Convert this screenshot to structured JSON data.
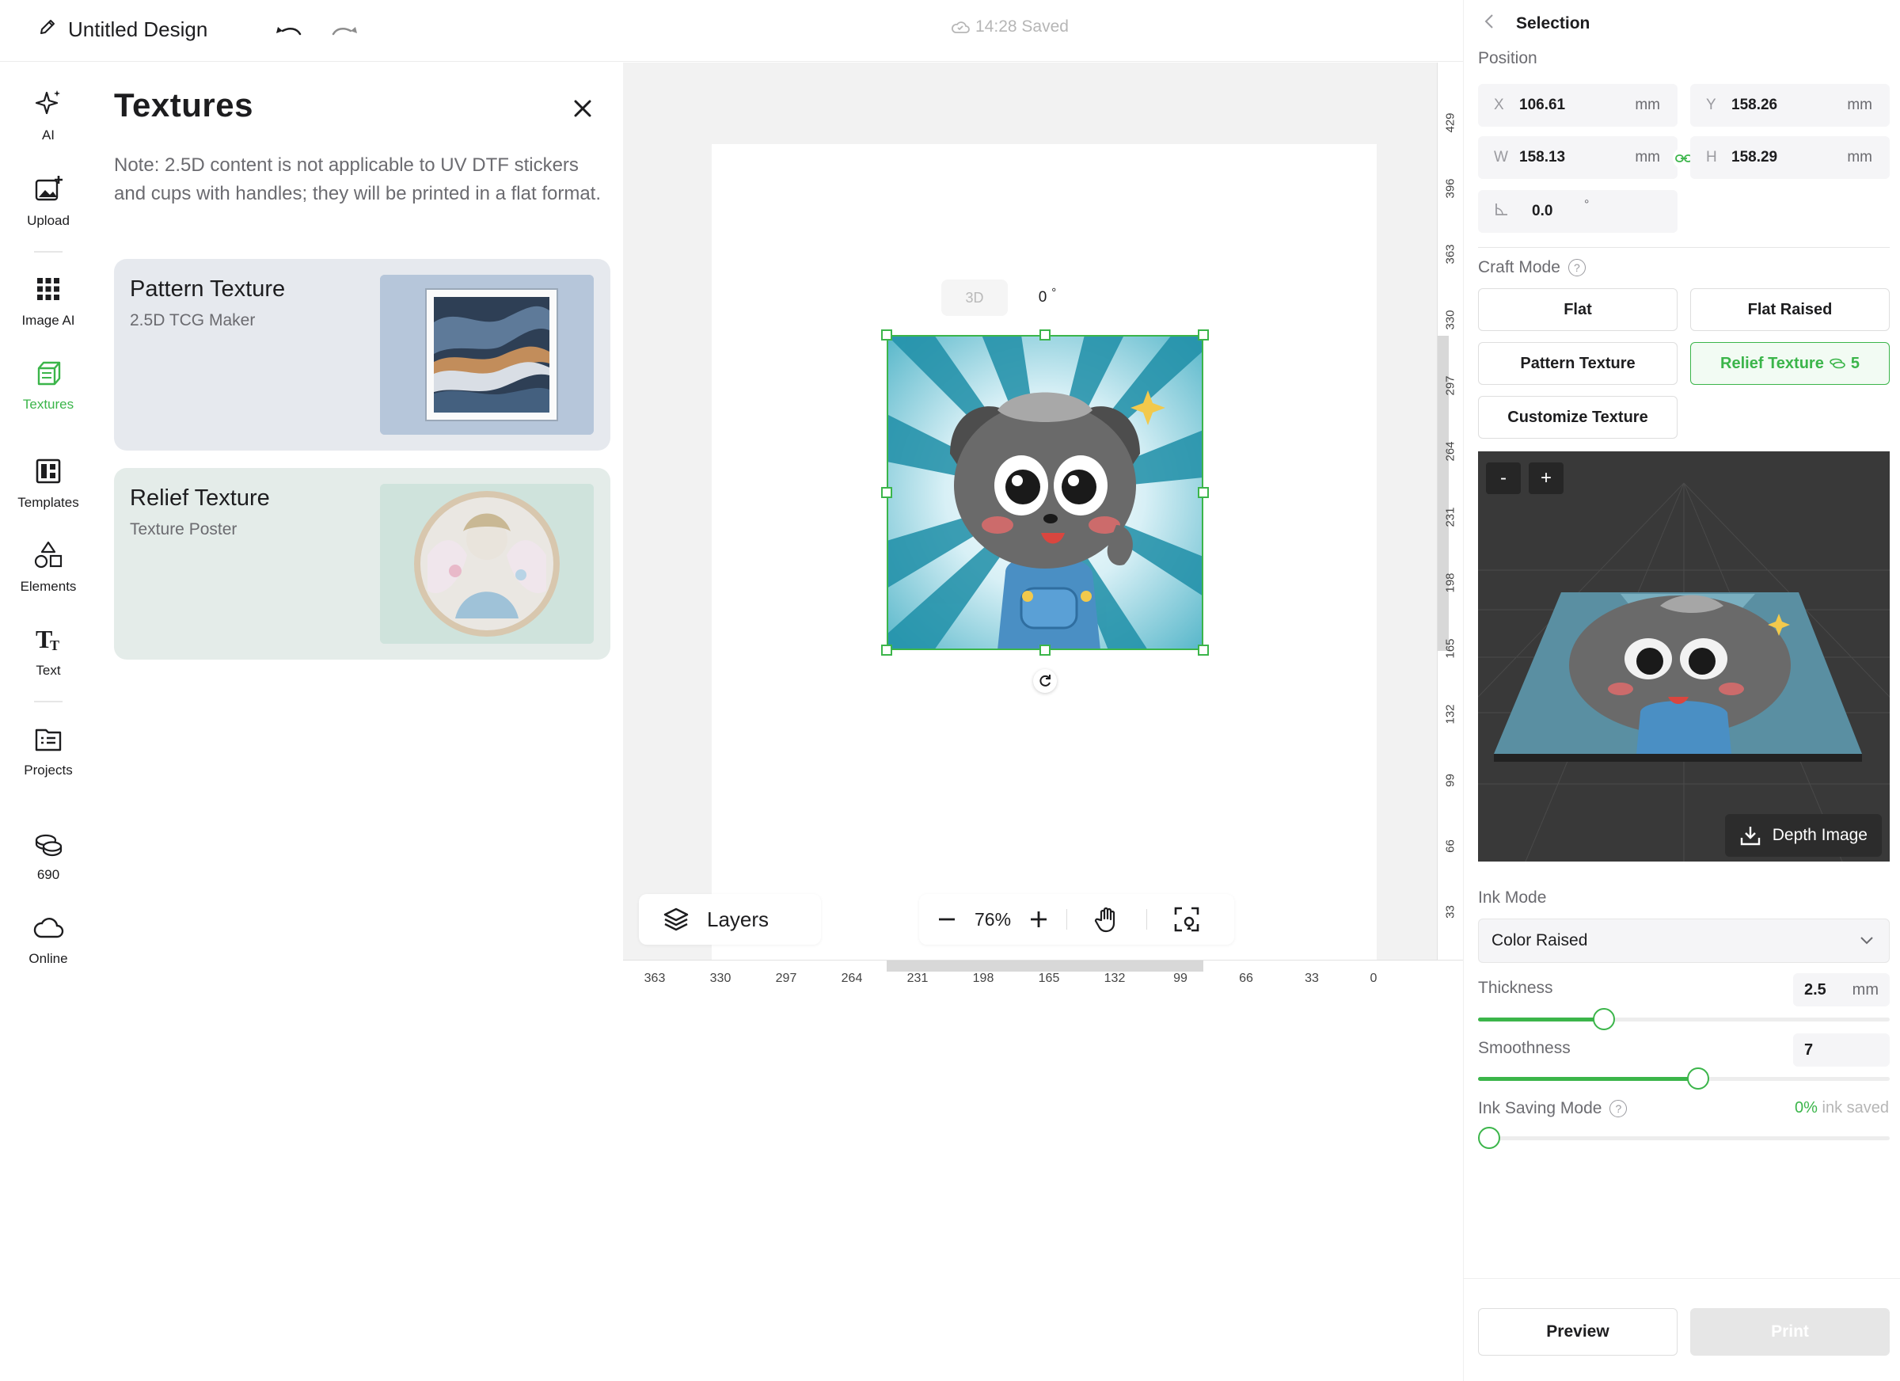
{
  "app": {
    "doc_title": "Untitled Design",
    "save_status": "14:28 Saved"
  },
  "rail": [
    {
      "label": "AI",
      "icon": "sparkle-icon"
    },
    {
      "label": "Upload",
      "icon": "upload-image-icon"
    },
    {
      "label": "Image AI",
      "icon": "grid-icon"
    },
    {
      "label": "Textures",
      "icon": "cube-icon",
      "active": true
    },
    {
      "label": "Templates",
      "icon": "template-icon"
    },
    {
      "label": "Elements",
      "icon": "shapes-icon"
    },
    {
      "label": "Text",
      "icon": "text-icon"
    },
    {
      "label": "Projects",
      "icon": "projects-icon"
    },
    {
      "label": "690",
      "icon": "coins-icon"
    },
    {
      "label": "Online",
      "icon": "cloud-icon"
    }
  ],
  "textures_panel": {
    "title": "Textures",
    "note": "Note: 2.5D content is not applicable to UV DTF stickers and cups with handles; they will be printed in a flat format.",
    "cards": [
      {
        "title": "Pattern Texture",
        "subtitle": "2.5D TCG Maker"
      },
      {
        "title": "Relief Texture",
        "subtitle": "Texture Poster"
      }
    ]
  },
  "canvas": {
    "toolbar_3d_label": "3D",
    "rotation_value": "0",
    "rotation_unit": "°",
    "layers_label": "Layers",
    "zoom_level": "76%",
    "ruler_v_ticks": [
      "429",
      "396",
      "363",
      "330",
      "297",
      "264",
      "231",
      "198",
      "165",
      "132",
      "99",
      "66",
      "33"
    ],
    "ruler_h_ticks": [
      "363",
      "330",
      "297",
      "264",
      "231",
      "198",
      "165",
      "132",
      "99",
      "66",
      "33",
      "0"
    ]
  },
  "selection": {
    "header": "Selection",
    "position_label": "Position",
    "x": {
      "key": "X",
      "value": "106.61",
      "unit": "mm"
    },
    "y": {
      "key": "Y",
      "value": "158.26",
      "unit": "mm"
    },
    "w": {
      "key": "W",
      "value": "158.13",
      "unit": "mm"
    },
    "h": {
      "key": "H",
      "value": "158.29",
      "unit": "mm"
    },
    "angle": {
      "value": "0.0",
      "unit": "°"
    },
    "craft_mode_label": "Craft Mode",
    "craft_modes": {
      "flat": "Flat",
      "flat_raised": "Flat Raised",
      "pattern_texture": "Pattern Texture",
      "relief_texture": "Relief Texture",
      "relief_cost": "5",
      "customize_texture": "Customize Texture"
    },
    "preview_minus": "-",
    "preview_plus": "+",
    "depth_image_label": "Depth Image",
    "ink_mode_label": "Ink Mode",
    "ink_mode_value": "Color Raised",
    "thickness": {
      "label": "Thickness",
      "value": "2.5",
      "unit": "mm",
      "slider_fraction": 0.305
    },
    "smoothness": {
      "label": "Smoothness",
      "value": "7",
      "slider_fraction": 0.535
    },
    "ink_saving": {
      "label": "Ink Saving Mode",
      "percent": "0%",
      "suffix": "ink saved",
      "slider_fraction": 0.0
    },
    "preview_button": "Preview",
    "print_button": "Print"
  },
  "colors": {
    "accent": "#3bb54a",
    "canvas_bg": "#f2f2f2",
    "card_pattern_bg": "#e6e9ee",
    "card_relief_bg": "#e4ece9",
    "preview_bg": "#393939",
    "print_disabled_bg": "#e6e6e6"
  }
}
